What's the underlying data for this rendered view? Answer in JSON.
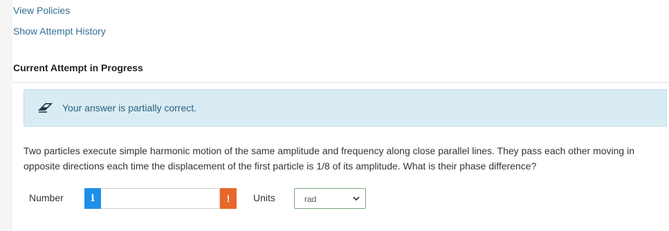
{
  "links": {
    "view_policies": "View Policies",
    "show_attempt_history": "Show Attempt History"
  },
  "attempt": {
    "title": "Current Attempt in Progress"
  },
  "feedback": {
    "icon": "eraser-icon",
    "text": "Your answer is partially correct."
  },
  "question": {
    "text": "Two particles execute simple harmonic motion of the same amplitude and frequency along close parallel lines. They pass each other moving in opposite directions each time the displacement of the first particle is 1/8 of its amplitude. What is their phase difference?"
  },
  "answer": {
    "number_label": "Number",
    "info_icon": "i",
    "number_value": "",
    "warning_icon": "!",
    "units_label": "Units",
    "units_selected": "rad"
  },
  "colors": {
    "link": "#2f6f93",
    "alert_bg": "#d9ecf4",
    "info_btn": "#1d8fe8",
    "warn_btn": "#e8672a"
  }
}
